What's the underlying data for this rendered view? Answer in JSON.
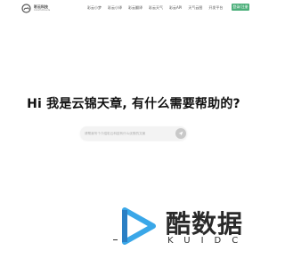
{
  "header": {
    "logo_name": "彩云科技",
    "logo_sub": "ColorfulClouds",
    "nav": [
      "彩云小梦",
      "彩云小译",
      "彩云翻译",
      "彩云天气",
      "彩云API",
      "天气云图",
      "开发平台"
    ],
    "login_label": "登录/注册"
  },
  "hero": {
    "title": "Hi 我是云锦天章, 有什么需要帮助的?"
  },
  "search": {
    "placeholder": "请帮我写个介绍彩云科技有什么优势的文案"
  },
  "watermark": {
    "title": "酷数据",
    "sub": "KUIDC"
  },
  "colors": {
    "accent": "#4caf7a",
    "play_blue": "#3aa7e8"
  }
}
